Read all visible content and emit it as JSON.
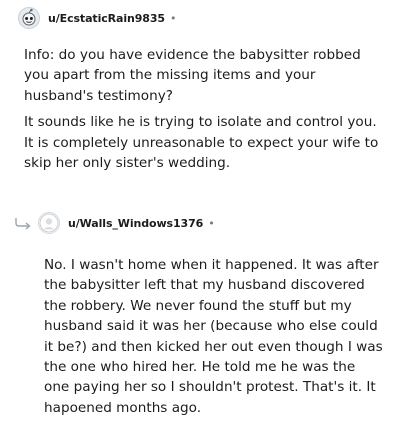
{
  "comments": [
    {
      "username": "u/EcstaticRain9835",
      "separator": "•",
      "avatar_icon": "snoo-avatar-icon",
      "paragraphs": [
        "Info: do you have evidence the babysitter robbed you apart from the missing items and your husband's testimony?",
        "It sounds like he is trying to isolate and control you. It is completely unreasonable to expect your wife to skip her only sister's wedding."
      ]
    },
    {
      "username": "u/Walls_Windows1376",
      "separator": "•",
      "avatar_icon": "default-avatar-icon",
      "reply_icon": "reply-arrow-icon",
      "paragraphs": [
        "No. I wasn't home when it happened. It was after the babysitter left that my husband discovered the robbery. We never found the stuff but my husband said it was her (because who else could it be?) and then kicked her out even though I was the one who hired her. He told me he was the one paying her so I shouldn't protest. That's it. It hapoened months ago."
      ]
    }
  ]
}
